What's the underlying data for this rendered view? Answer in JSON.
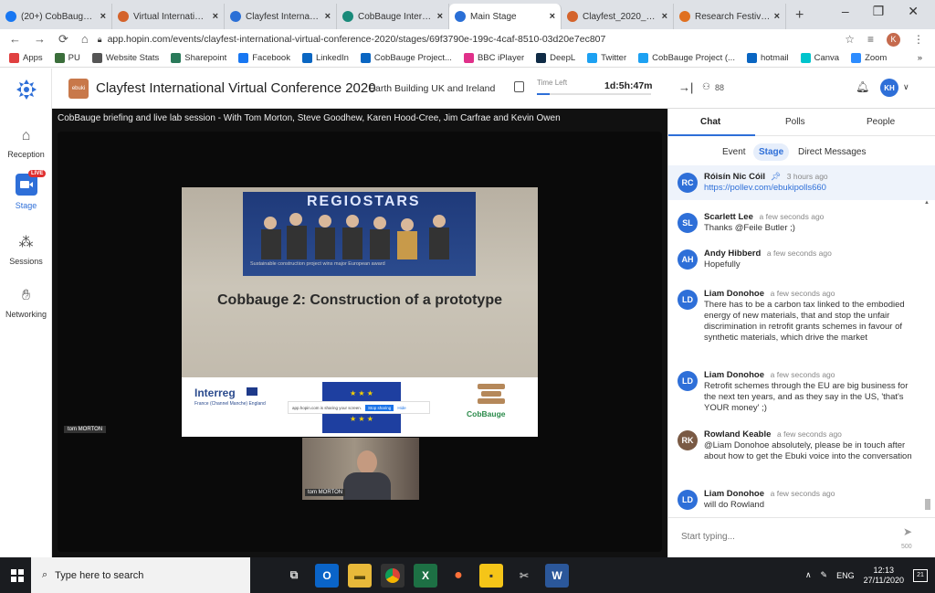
{
  "browser": {
    "tabs": [
      {
        "label": "(20+) CobBauge Pro",
        "color": "#1877f2"
      },
      {
        "label": "Virtual International",
        "color": "#d4632b"
      },
      {
        "label": "Clayfest Internationa",
        "color": "#2a6fd6"
      },
      {
        "label": "CobBauge Interreg",
        "color": "#1a8a7a"
      },
      {
        "label": "Main Stage",
        "color": "#2a6fd6"
      },
      {
        "label": "Clayfest_2020_Sche",
        "color": "#d4632b"
      },
      {
        "label": "Research Festival 20",
        "color": "#e07020"
      }
    ],
    "new_tab": "+",
    "window_controls": [
      "–",
      "❐",
      "✕"
    ],
    "url": "app.hopin.com/events/clayfest-international-virtual-conference-2020/stages/69f3790e-199c-4caf-8510-03d20e7ec807",
    "profile_initial": "K",
    "bookmarks": [
      {
        "label": "Apps",
        "color": "#e04040"
      },
      {
        "label": "PU",
        "color": "#3b6e3b"
      },
      {
        "label": "Website Stats",
        "color": "#555555"
      },
      {
        "label": "Sharepoint",
        "color": "#2a7a5a"
      },
      {
        "label": "Facebook",
        "color": "#1877f2"
      },
      {
        "label": "LinkedIn",
        "color": "#0a66c2"
      },
      {
        "label": "CobBauge Project...",
        "color": "#0a66c2"
      },
      {
        "label": "BBC iPlayer",
        "color": "#e0308a"
      },
      {
        "label": "DeepL",
        "color": "#0f2b46"
      },
      {
        "label": "Twitter",
        "color": "#1da1f2"
      },
      {
        "label": "CobBauge Project (...",
        "color": "#1da1f2"
      },
      {
        "label": "hotmail",
        "color": "#0a66c2"
      },
      {
        "label": "Canva",
        "color": "#00c4cc"
      },
      {
        "label": "Zoom",
        "color": "#2d8cff"
      }
    ],
    "bookmarks_more": "»"
  },
  "sidebar": {
    "items": [
      {
        "label": "Reception",
        "icon": "home-icon"
      },
      {
        "label": "Stage",
        "icon": "camera-icon",
        "badge": "LIVE"
      },
      {
        "label": "Sessions",
        "icon": "people-icon"
      },
      {
        "label": "Networking",
        "icon": "handshake-icon"
      }
    ]
  },
  "header": {
    "logo_text": "ebuki",
    "title": "Clayfest International Virtual Conference 2020",
    "org": "Earth Building UK and Ireland",
    "time_left_label": "Time Left",
    "time_left": "1d:5h:47m",
    "attendees": "88",
    "user_initials": "KH"
  },
  "stage": {
    "title": "CobBauge briefing and live lab session - With Tom Morton, Steve Goodhew, Karen Hood-Cree, Jim Carfrae and Kevin Owen",
    "slide_banner": "REGIOSTARS",
    "slide_caption": "Sustainable construction project wins major European award",
    "slide_title": "Cobbauge 2: Construction of a prototype",
    "interreg": "Interreg",
    "interreg_sub": "France (Channel Manche) England",
    "cobbauge": "CobBauge",
    "share_text": "app.hopin.com is sharing your screen.",
    "share_stop": "Stop sharing",
    "share_hide": "Hide",
    "presenter_label": "tom MORTON",
    "cam_label": "tom MORTON"
  },
  "chat": {
    "tabs": [
      "Chat",
      "Polls",
      "People"
    ],
    "subtabs": [
      "Event",
      "Stage",
      "Direct Messages"
    ],
    "pinned": {
      "initials": "RC",
      "name": "Róisín Nic Cóil",
      "time": "3 hours ago",
      "text": "https://pollev.com/ebukipolls660"
    },
    "messages": [
      {
        "initials": "SL",
        "name": "Scarlett Lee",
        "time": "a few seconds ago",
        "text": "Thanks @Feile Butler ;)"
      },
      {
        "initials": "AH",
        "name": "Andy Hibberd",
        "time": "a few seconds ago",
        "text": "Hopefully"
      },
      {
        "initials": "LD",
        "name": "Liam Donohoe",
        "time": "a few seconds ago",
        "text": "There has to be a carbon tax linked to the embodied energy of new materials, that and stop the unfair discrimination in retrofit grants schemes in favour of synthetic materials, which drive the market"
      },
      {
        "initials": "LD",
        "name": "Liam Donohoe",
        "time": "a few seconds ago",
        "text": "Retrofit schemes through the EU are big business for the next ten years, and as they say in the US, 'that's YOUR money' ;)"
      },
      {
        "initials": "RK",
        "name": "Rowland Keable",
        "time": "a few seconds ago",
        "text": "@Liam Donohoe absolutely, please be in touch after about how to get the Ebuki voice into the conversation"
      },
      {
        "initials": "LD",
        "name": "Liam Donohoe",
        "time": "a few seconds ago",
        "text": "will do Rowland"
      }
    ],
    "input_placeholder": "Start typing...",
    "char_count": "500"
  },
  "taskbar": {
    "search_placeholder": "Type here to search",
    "lang": "ENG",
    "time": "12:13",
    "date": "27/11/2020",
    "notif_count": "21"
  }
}
